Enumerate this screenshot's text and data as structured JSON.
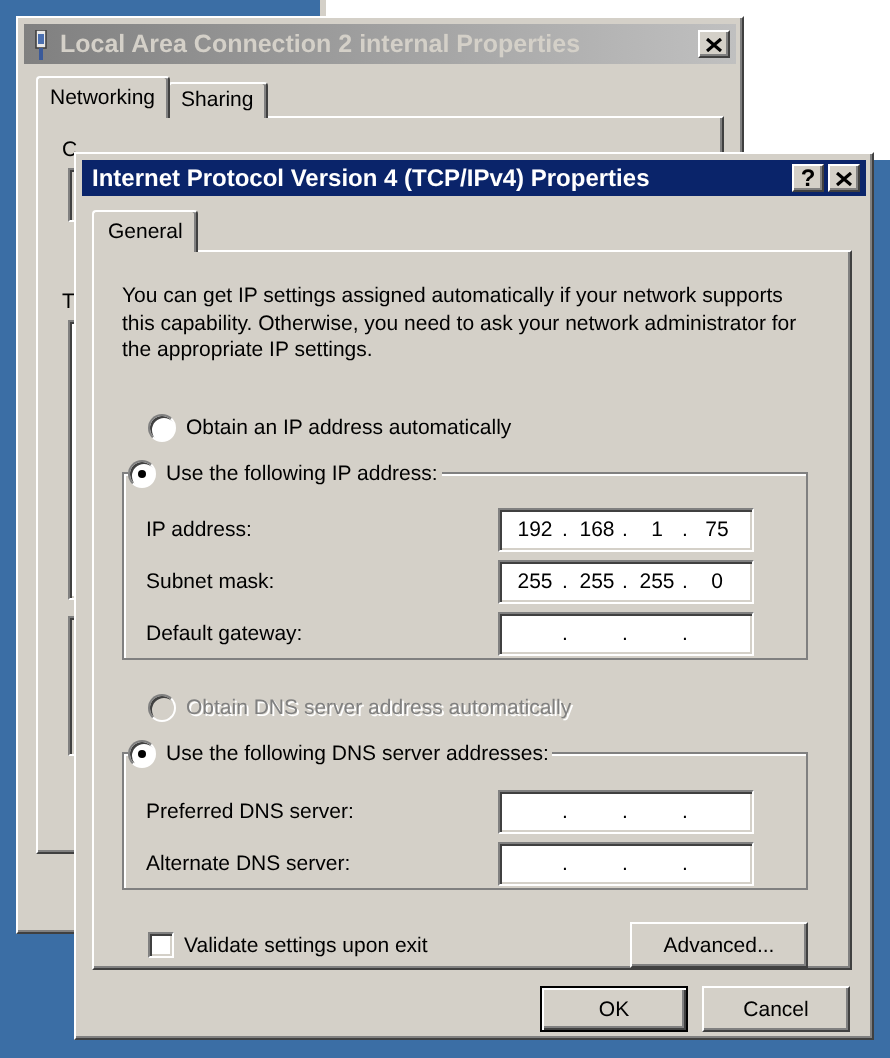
{
  "back_window": {
    "title": "Local Area Connection 2 internal Properties",
    "tabs": [
      {
        "label": "Networking",
        "selected": true
      },
      {
        "label": "Sharing",
        "selected": false
      }
    ],
    "label_1": "C",
    "label_2": "T"
  },
  "dialog": {
    "title": "Internet Protocol Version 4 (TCP/IPv4) Properties",
    "help_button": "?",
    "tabs": [
      {
        "label": "General",
        "selected": true
      }
    ],
    "intro": "You can get IP settings assigned automatically if your network supports this capability. Otherwise, you need to ask your network administrator for the appropriate IP settings.",
    "ip_options": [
      {
        "label": "Obtain an IP address automatically",
        "selected": false,
        "disabled": false
      },
      {
        "label": "Use the following IP address:",
        "selected": true,
        "disabled": false
      }
    ],
    "ip_fields": [
      {
        "label": "IP address:",
        "octets": [
          "192",
          "168",
          "1",
          "75"
        ],
        "separators": [
          ".",
          ".",
          "."
        ]
      },
      {
        "label": "Subnet mask:",
        "octets": [
          "255",
          "255",
          "255",
          "0"
        ],
        "separators": [
          ".",
          ".",
          "."
        ]
      },
      {
        "label": "Default gateway:",
        "separators": [
          ".",
          ".",
          "."
        ]
      }
    ],
    "dns_options": [
      {
        "label": "Obtain DNS server address automatically",
        "selected": false,
        "disabled": true
      },
      {
        "label": "Use the following DNS server addresses:",
        "selected": true,
        "disabled": false
      }
    ],
    "dns_fields": [
      {
        "label": "Preferred DNS server:",
        "separators": [
          ".",
          ".",
          "."
        ]
      },
      {
        "label": "Alternate DNS server:",
        "separators": [
          ".",
          ".",
          "."
        ]
      }
    ],
    "validate": {
      "label": "Validate settings upon exit",
      "checked": false
    },
    "advanced_button": "Advanced...",
    "buttons": [
      {
        "label": "OK",
        "default": true
      },
      {
        "label": "Cancel",
        "default": false
      }
    ]
  }
}
